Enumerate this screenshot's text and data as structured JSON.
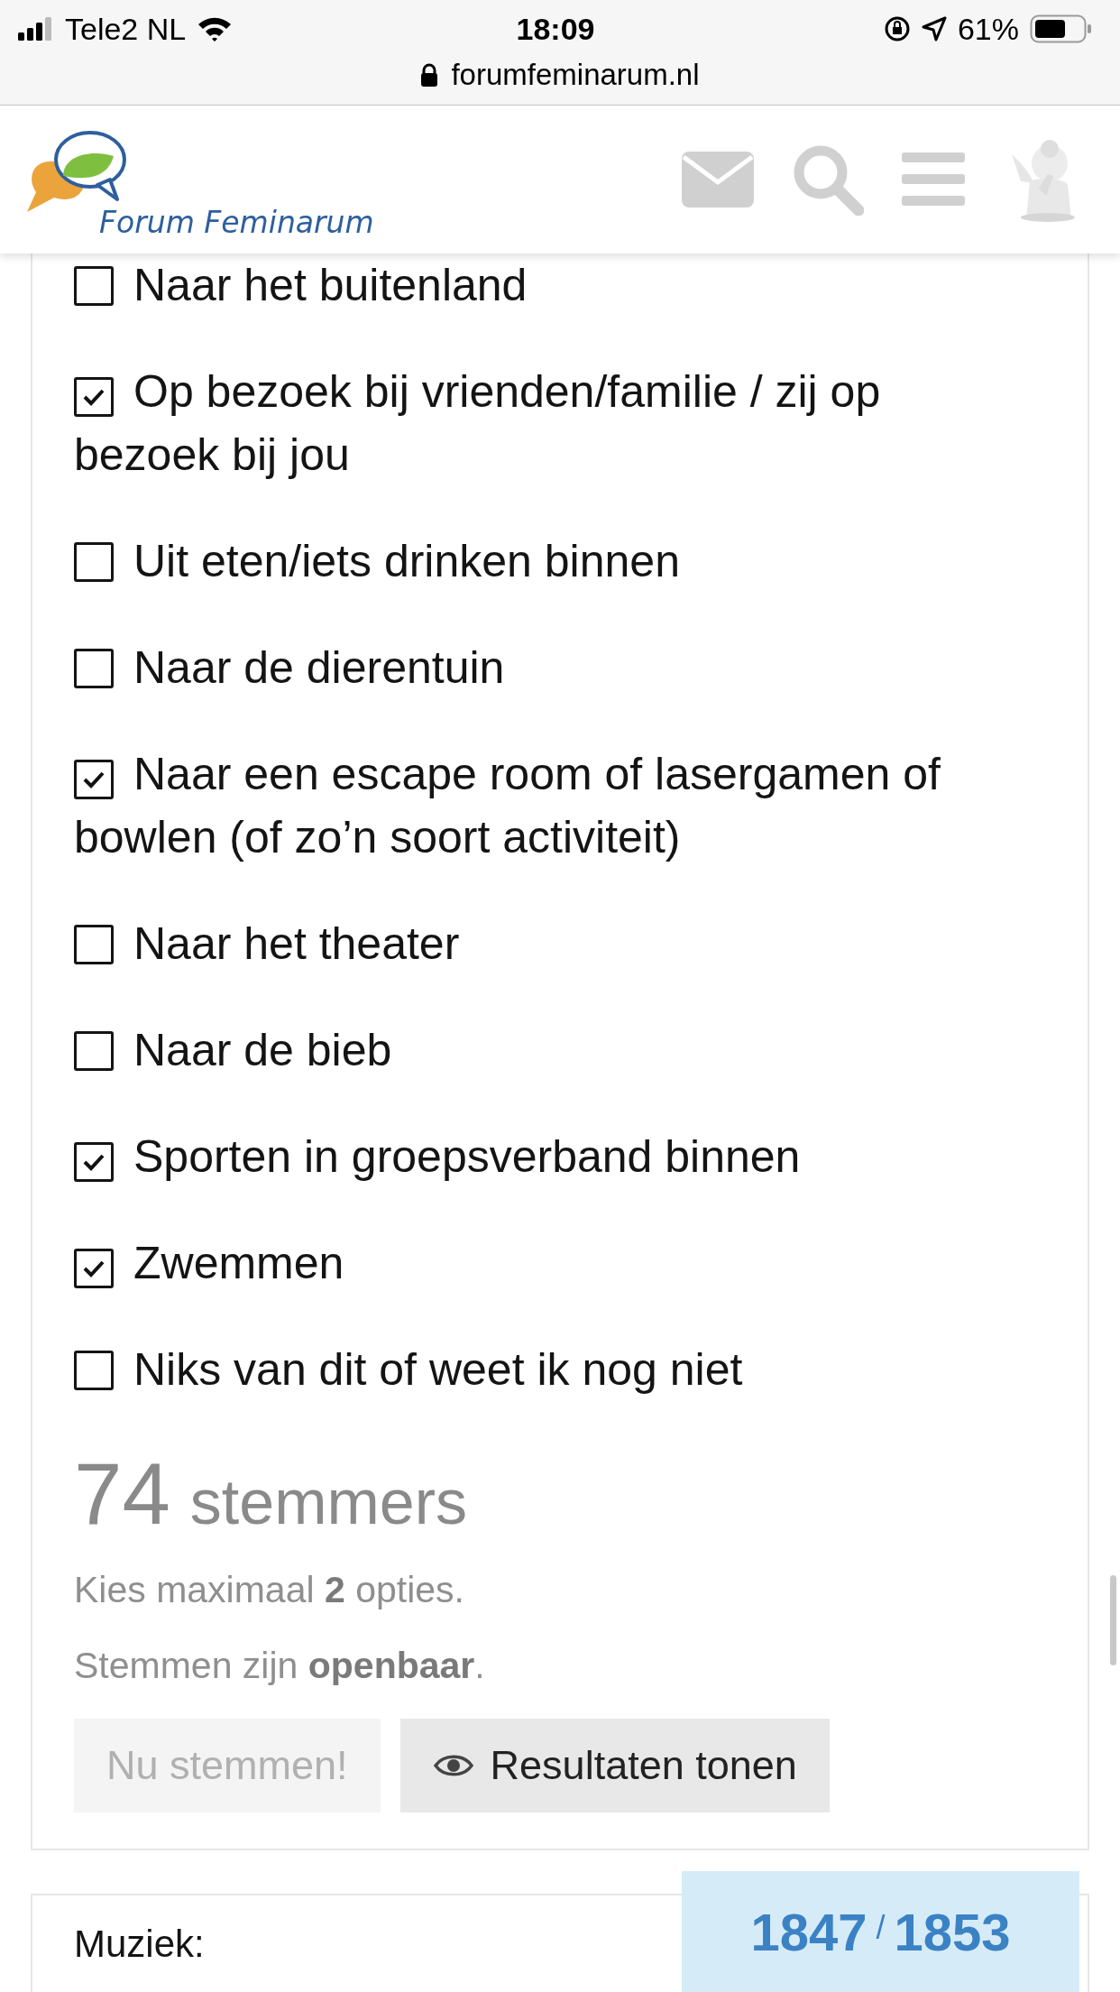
{
  "status_bar": {
    "carrier": "Tele2 NL",
    "time": "18:09",
    "battery": "61%",
    "url": "forumfeminarum.nl"
  },
  "header": {
    "logo_text": "Forum Feminarum"
  },
  "poll": {
    "options": [
      {
        "label": "Naar het buitenland",
        "checked": false
      },
      {
        "label": "Op bezoek bij vrienden/familie / zij op bezoek bij jou",
        "checked": true
      },
      {
        "label": "Uit eten/iets drinken binnen",
        "checked": false
      },
      {
        "label": "Naar de dierentuin",
        "checked": false
      },
      {
        "label": "Naar een escape room of lasergamen of bowlen (of zo’n soort activiteit)",
        "checked": true
      },
      {
        "label": "Naar het theater",
        "checked": false
      },
      {
        "label": "Naar de bieb",
        "checked": false
      },
      {
        "label": "Sporten in groepsverband binnen",
        "checked": true
      },
      {
        "label": "Zwemmen",
        "checked": true
      },
      {
        "label": "Niks van dit of weet ik nog niet",
        "checked": false
      }
    ],
    "voters_count": "74",
    "voters_label": "stemmers",
    "notes": [
      "Kies maximaal **2** opties.",
      "Stemmen zijn **openbaar**."
    ],
    "buttons": [
      {
        "kind": "vote",
        "label": "Nu stemmen!",
        "disabled": true
      },
      {
        "kind": "results",
        "label": "Resultaten tonen",
        "disabled": false
      }
    ]
  },
  "next_card": {
    "title": "Muziek:"
  },
  "page_counter": {
    "current": "1847",
    "separator": "/",
    "total": "1853"
  }
}
